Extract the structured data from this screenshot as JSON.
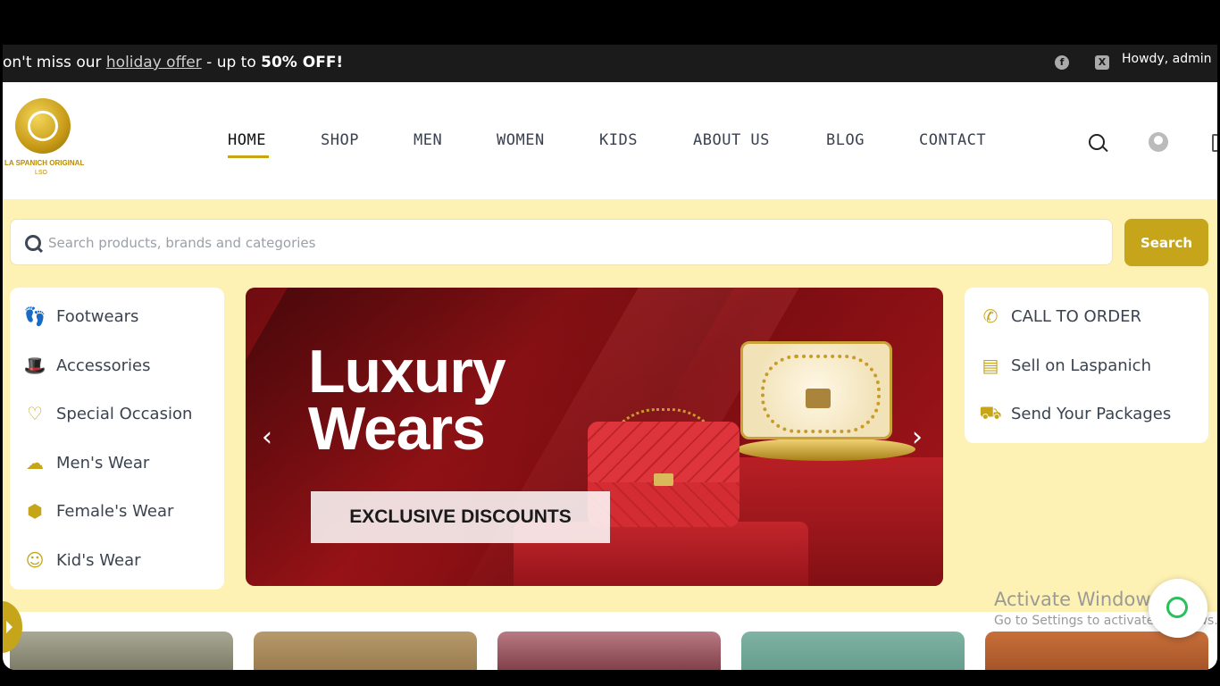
{
  "topbar": {
    "promo_prefix": "on't miss our ",
    "promo_link": "holiday offer",
    "promo_middle": " - up to ",
    "promo_bold": "50% OFF!",
    "social": {
      "facebook": "f",
      "x": "X"
    },
    "howdy": "Howdy, admin"
  },
  "logo": {
    "text": "LA SPANICH ORIGINAL",
    "sub": "LSO"
  },
  "nav": {
    "items": [
      "HOME",
      "SHOP",
      "MEN",
      "WOMEN",
      "KIDS",
      "ABOUT US",
      "BLOG",
      "CONTACT"
    ],
    "active": "HOME"
  },
  "search": {
    "placeholder": "Search products, brands and categories",
    "button": "Search"
  },
  "categories": [
    {
      "label": "Footwears",
      "icon": "footprints-icon"
    },
    {
      "label": "Accessories",
      "icon": "hat-icon"
    },
    {
      "label": "Special Occasion",
      "icon": "heart-icon"
    },
    {
      "label": "Men's Wear",
      "icon": "cloud-rain-icon"
    },
    {
      "label": "Female's Wear",
      "icon": "dice-icon"
    },
    {
      "label": "Kid's Wear",
      "icon": "smile-icon"
    }
  ],
  "hero": {
    "title_line1": "Luxury",
    "title_line2": "Wears",
    "badge": "EXCLUSIVE DISCOUNTS",
    "prev": "‹",
    "next": "›"
  },
  "right_panel": [
    {
      "label": "CALL TO ORDER",
      "icon": "phone-icon"
    },
    {
      "label": "Sell on Laspanich",
      "icon": "warehouse-icon"
    },
    {
      "label": "Send Your Packages",
      "icon": "truck-icon"
    }
  ],
  "activate_windows": {
    "title": "Activate Windows",
    "subtitle": "Go to Settings to activate Windows."
  },
  "colors": {
    "accent": "#c6a51a",
    "banner_bg": "#fdf1b3",
    "topbar": "#1b1b1b"
  }
}
